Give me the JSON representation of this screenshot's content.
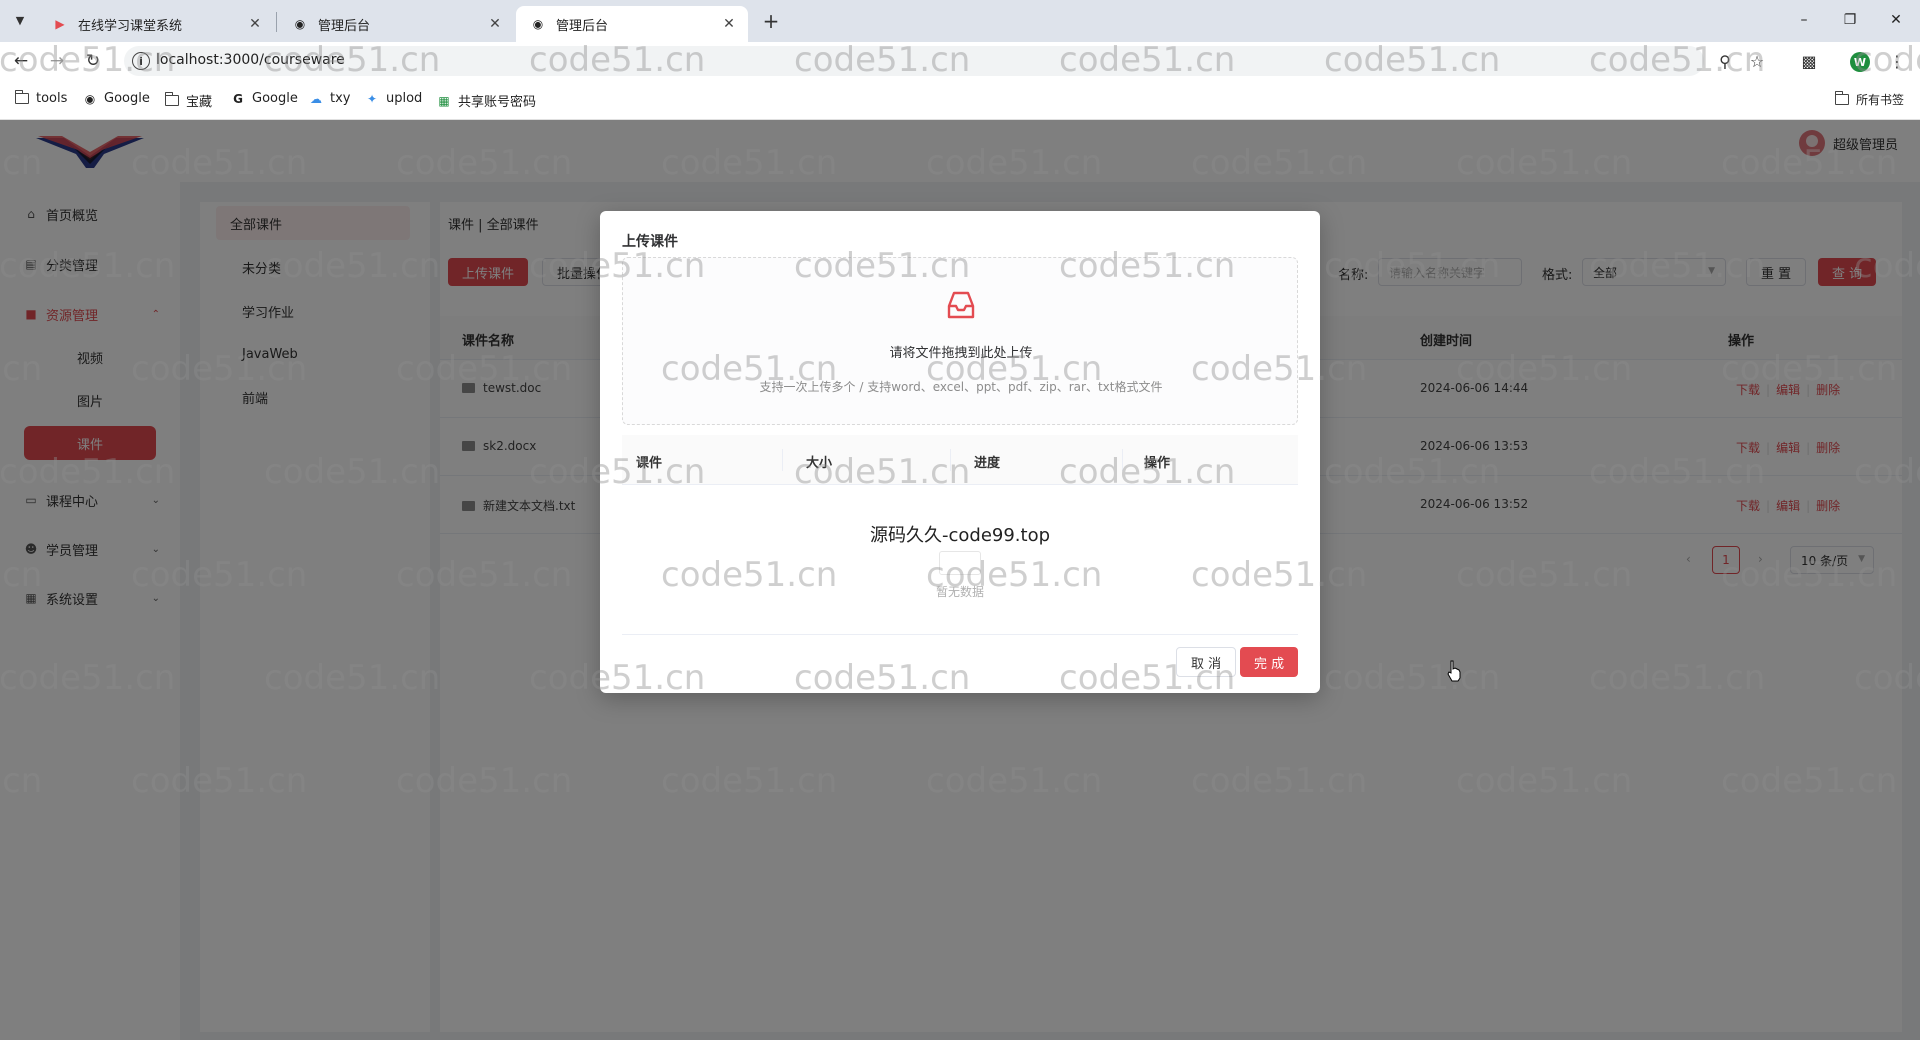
{
  "browser": {
    "tabs": [
      {
        "title": "在线学习课堂系统",
        "favicon": "play-icon",
        "active": false
      },
      {
        "title": "管理后台",
        "favicon": "globe-icon",
        "active": false
      },
      {
        "title": "管理后台",
        "favicon": "globe-icon",
        "active": true
      }
    ],
    "url": "localhost:3000/courseware",
    "bookmarks": [
      "tools",
      "Google",
      "宝藏",
      "Google",
      "txy",
      "uplod",
      "共享账号密码"
    ],
    "all_bookmarks": "所有书签",
    "profile_initial": "W"
  },
  "header": {
    "user_name": "超级管理员"
  },
  "sidebar": {
    "items": [
      {
        "label": "首页概览",
        "icon": "home-icon"
      },
      {
        "label": "分类管理",
        "icon": "category-icon"
      },
      {
        "label": "资源管理",
        "icon": "folder-icon",
        "open": true,
        "children": [
          "视频",
          "图片",
          "课件"
        ],
        "active_child": "课件"
      },
      {
        "label": "课程中心",
        "icon": "monitor-icon"
      },
      {
        "label": "学员管理",
        "icon": "user-icon"
      },
      {
        "label": "系统设置",
        "icon": "settings-icon"
      }
    ]
  },
  "subnav": {
    "items": [
      "全部课件",
      "未分类",
      "学习作业",
      "JavaWeb",
      "前端"
    ],
    "active": "全部课件"
  },
  "content": {
    "breadcrumb": "课件 | 全部课件",
    "upload_button": "上传课件",
    "batch_button": "批量操作",
    "filter_name_label": "名称:",
    "filter_name_placeholder": "请输入名称关键字",
    "filter_format_label": "格式:",
    "filter_format_value": "全部",
    "reset_button": "重 置",
    "query_button": "查 询",
    "columns": [
      "课件名称",
      "创建时间",
      "操作"
    ],
    "rows": [
      {
        "name": "tewst.doc",
        "created": "2024-06-06 14:44"
      },
      {
        "name": "sk2.docx",
        "created": "2024-06-06 13:53"
      },
      {
        "name": "新建文本文档.txt",
        "created": "2024-06-06 13:52"
      }
    ],
    "row_actions": [
      "下载",
      "编辑",
      "删除"
    ],
    "pagination": {
      "current": "1",
      "page_size": "10 条/页"
    }
  },
  "dialog": {
    "title": "上传课件",
    "drop_main": "请将文件拖拽到此处上传",
    "drop_hint": "支持一次上传多个 / 支持word、excel、ppt、pdf、zip、rar、txt格式文件",
    "columns": [
      "课件",
      "大小",
      "进度",
      "操作"
    ],
    "banner": "源码久久-code99.top",
    "empty_text": "暂无数据",
    "cancel_button": "取 消",
    "done_button": "完 成"
  },
  "watermark_text": "code51.cn",
  "colors": {
    "accent": "#e34b51",
    "tabbar": "#dee3eb",
    "app_bg": "#f0f2f5"
  }
}
